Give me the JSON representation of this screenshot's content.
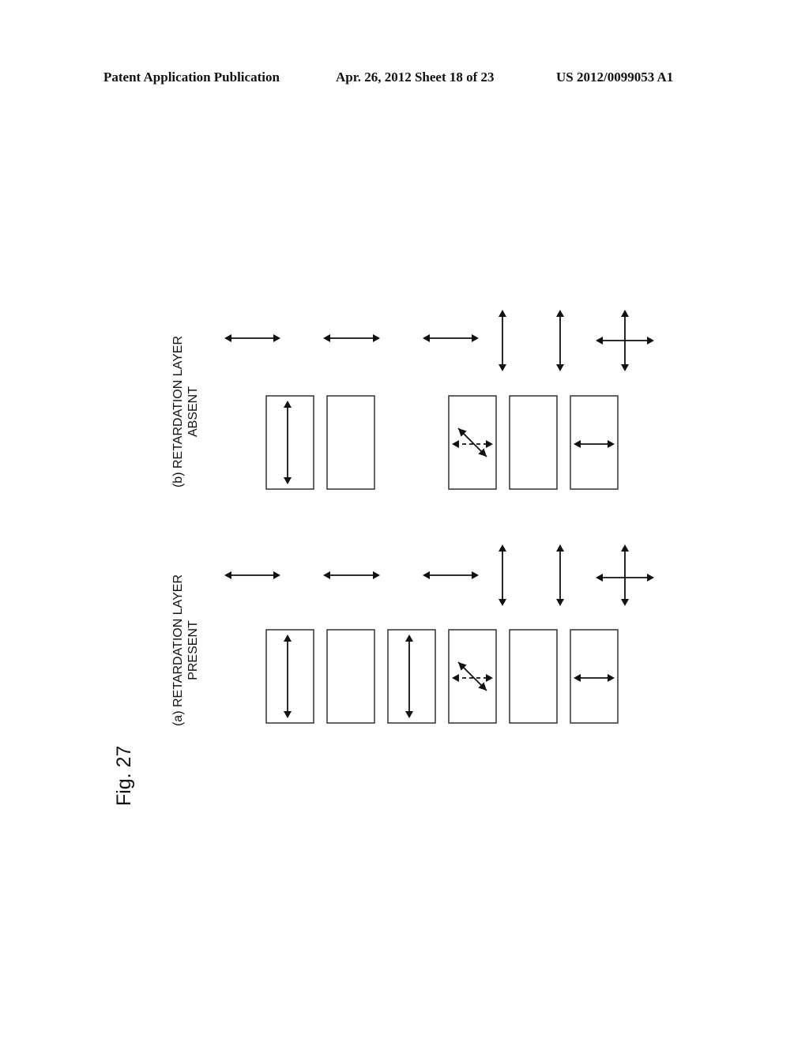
{
  "header": {
    "publication": "Patent Application Publication",
    "date_sheet": "Apr. 26, 2012  Sheet 18 of 23",
    "number": "US 2012/0099053 A1"
  },
  "figure": {
    "label": "Fig. 27",
    "panels": [
      {
        "id": "b",
        "title_line1": "(b) RETARDATION LAYER",
        "title_line2": "ABSENT",
        "top_arrows": [
          "horizontal",
          "horizontal",
          "horizontal",
          "vertical",
          "vertical",
          "cross"
        ],
        "cells": [
          "vertical-arrow",
          "empty",
          "none",
          "diagonal-with-dashed-horizontal",
          "empty",
          "horizontal-arrow"
        ]
      },
      {
        "id": "a",
        "title_line1": "(a) RETARDATION LAYER",
        "title_line2": "PRESENT",
        "top_arrows": [
          "horizontal",
          "horizontal",
          "horizontal",
          "vertical",
          "vertical",
          "cross"
        ],
        "cells": [
          "vertical-arrow",
          "empty",
          "vertical-arrow",
          "diagonal-with-dashed-horizontal",
          "empty",
          "horizontal-arrow"
        ]
      }
    ]
  }
}
